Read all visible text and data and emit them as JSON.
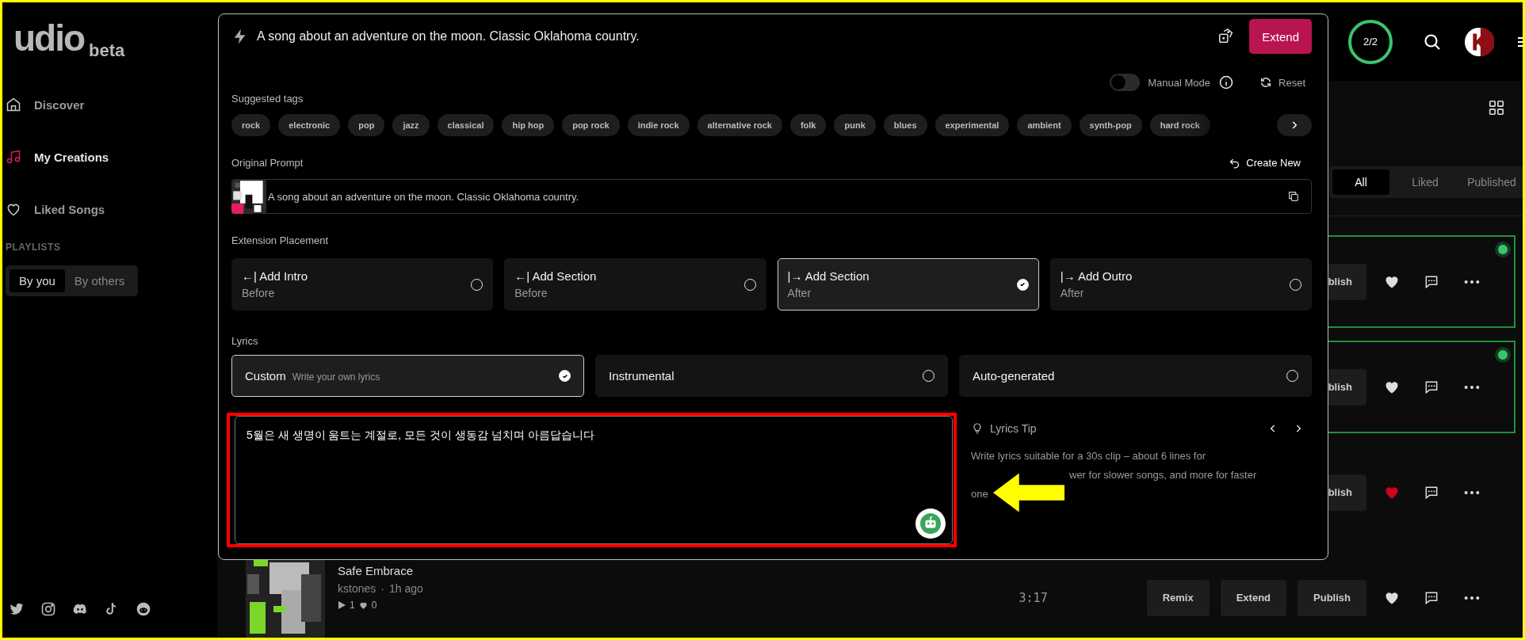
{
  "sidebar": {
    "logo": "udio",
    "logo_badge": "beta",
    "nav": [
      {
        "label": "Discover",
        "selected": false
      },
      {
        "label": "My Creations",
        "selected": true
      },
      {
        "label": "Liked Songs",
        "selected": false
      }
    ],
    "playlists_heading": "PLAYLISTS",
    "playlist_tabs": [
      {
        "label": "By you",
        "selected": true
      },
      {
        "label": "By others",
        "selected": false
      }
    ]
  },
  "header": {
    "credits": "2/2"
  },
  "library": {
    "tabs": [
      {
        "label": "All",
        "selected": true
      },
      {
        "label": "Liked",
        "selected": false
      },
      {
        "label": "Published",
        "selected": false
      }
    ],
    "songs": [
      {
        "selected": true,
        "liked": false,
        "buttons": [
          "blish"
        ]
      },
      {
        "selected": true,
        "liked": false,
        "buttons": [
          "blish"
        ]
      },
      {
        "selected": false,
        "liked": true,
        "buttons": [
          "blish"
        ]
      },
      {
        "selected": false,
        "liked": false,
        "title": "Safe Embrace",
        "artist": "kstones",
        "separator": "·",
        "age": "1h ago",
        "plays": "1",
        "likes": "0",
        "duration": "3:17",
        "buttons": [
          "Remix",
          "Extend",
          "Publish"
        ]
      }
    ]
  },
  "modal": {
    "prompt": "A song about an adventure on the moon. Classic Oklahoma country.",
    "extend_button": "Extend",
    "manual_mode": {
      "label": "Manual Mode",
      "on": false
    },
    "reset": "Reset",
    "tags_heading": "Suggested tags",
    "tags": [
      "rock",
      "electronic",
      "pop",
      "jazz",
      "classical",
      "hip hop",
      "pop rock",
      "indie rock",
      "alternative rock",
      "folk",
      "punk",
      "blues",
      "experimental",
      "ambient",
      "synth-pop",
      "hard rock"
    ],
    "original_prompt_heading": "Original Prompt",
    "create_new": "Create New",
    "original_prompt": "A song about an adventure on the moon. Classic Oklahoma country.",
    "placement_heading": "Extension Placement",
    "placements": [
      {
        "arrow": "←|",
        "label": "Add Intro",
        "position": "Before",
        "selected": false
      },
      {
        "arrow": "←|",
        "label": "Add Section",
        "position": "Before",
        "selected": false
      },
      {
        "arrow": "|→",
        "label": "Add Section",
        "position": "After",
        "selected": true
      },
      {
        "arrow": "|→",
        "label": "Add Outro",
        "position": "After",
        "selected": false
      }
    ],
    "lyrics_heading": "Lyrics",
    "lyrics_modes": [
      {
        "label": "Custom",
        "hint": "Write your own lyrics",
        "selected": true
      },
      {
        "label": "Instrumental",
        "selected": false
      },
      {
        "label": "Auto-generated",
        "selected": false
      }
    ],
    "lyrics": "5월은 새 생명이 움트는 계절로, 모든 것이 생동감 넘치며 아름답습니다",
    "tip": {
      "title": "Lyrics Tip",
      "lines": [
        "Write lyrics suitable for a 30s clip – about 6 lines for",
        "wer for slower songs, and more for faster",
        "one"
      ]
    }
  }
}
